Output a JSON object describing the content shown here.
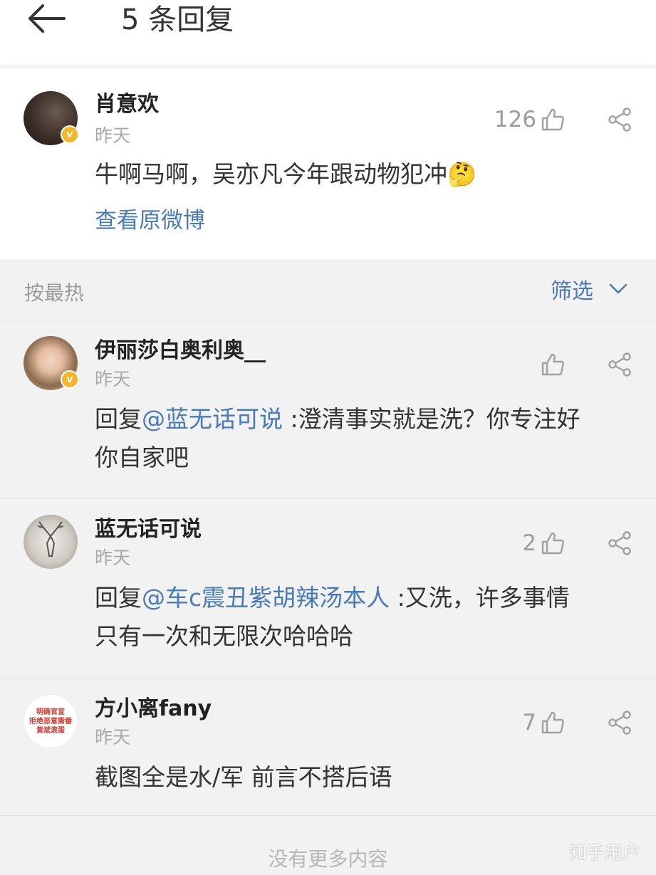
{
  "header": {
    "title": "5 条回复"
  },
  "main_comment": {
    "username": "肖意欢",
    "time": "昨天",
    "likes": "126",
    "text": "牛啊马啊，吴亦凡今年跟动物犯冲",
    "emoji": "🤔",
    "view_original": "查看原微博"
  },
  "sort": {
    "label": "按最热",
    "filter_label": "筛选"
  },
  "replies": [
    {
      "username": "伊丽莎白奥利奥__",
      "time": "昨天",
      "likes": "",
      "prefix": "回复",
      "mention": "@蓝无话可说",
      "text_line1": " :澄清事实就是洗？你专注好",
      "text_line2": "你自家吧"
    },
    {
      "username": "蓝无话可说",
      "time": "昨天",
      "likes": "2",
      "prefix": "回复",
      "mention": "@车c震丑紫胡辣汤本人",
      "text_line1": " :又洗，许多事情",
      "text_line2": "只有一次和无限次哈哈哈"
    },
    {
      "username": "方小离fany",
      "time": "昨天",
      "likes": "7",
      "avatar_lines": [
        "明确官宣",
        "拒绝恶意撕番",
        "黄斌滚蛋"
      ],
      "text_line1": "截图全是水/军 前言不搭后语"
    }
  ],
  "footer": {
    "text": "没有更多内容",
    "watermark": "知乎用户"
  },
  "colors": {
    "accent": "#4a7ab8",
    "badge": "#f5b52a",
    "muted": "#9c9c9c"
  }
}
